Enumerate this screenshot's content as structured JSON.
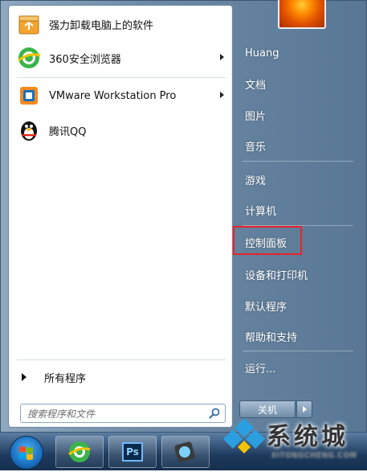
{
  "programs": [
    {
      "label": "强力卸载电脑上的软件",
      "icon": "uninstall-box-icon",
      "submenu": false
    },
    {
      "label": "360安全浏览器",
      "icon": "360-browser-icon",
      "submenu": true
    },
    {
      "label": "VMware Workstation Pro",
      "icon": "vmware-icon",
      "submenu": true
    },
    {
      "label": "腾讯QQ",
      "icon": "qq-penguin-icon",
      "submenu": false
    }
  ],
  "all_programs_label": "所有程序",
  "search": {
    "placeholder": "搜索程序和文件"
  },
  "right_items": [
    {
      "label": "Huang"
    },
    {
      "label": "文档"
    },
    {
      "label": "图片"
    },
    {
      "label": "音乐"
    },
    {
      "label": "游戏"
    },
    {
      "label": "计算机"
    },
    {
      "label": "控制面板",
      "highlighted": true
    },
    {
      "label": "设备和打印机"
    },
    {
      "label": "默认程序"
    },
    {
      "label": "帮助和支持"
    },
    {
      "label": "运行..."
    }
  ],
  "shutdown_label": "关机",
  "taskbar": {
    "items": [
      "start-orb",
      "360-browser-icon",
      "photoshop-icon",
      "app-icon"
    ],
    "ps_label": "Ps"
  },
  "watermark": {
    "text": "系统城",
    "sub": "XITONGCHENG.COM"
  },
  "colors": {
    "highlight_border": "#e8242b",
    "frame": "#6d8aa5"
  }
}
